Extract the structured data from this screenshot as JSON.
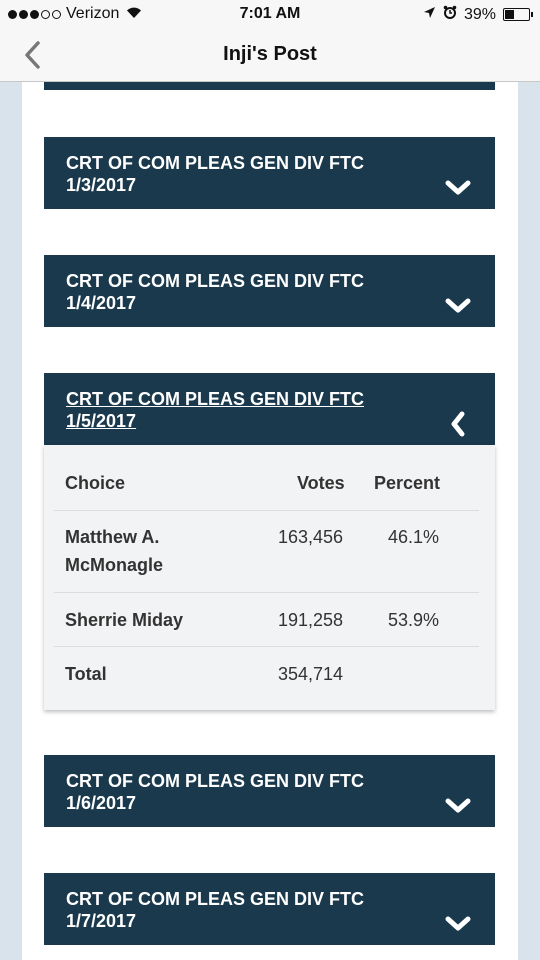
{
  "status_bar": {
    "carrier": "Verizon",
    "time": "7:01 AM",
    "battery": "39%",
    "battery_level": 0.39
  },
  "nav": {
    "title": "Inji's Post"
  },
  "panels": [
    {
      "title": "CRT OF COM PLEAS GEN DIV FTC",
      "date": "1/3/2017",
      "expanded": false
    },
    {
      "title": "CRT OF COM PLEAS GEN DIV FTC",
      "date": "1/4/2017",
      "expanded": false
    },
    {
      "title": "CRT OF COM PLEAS GEN DIV FTC",
      "date": "1/5/2017",
      "expanded": true
    },
    {
      "title": "CRT OF COM PLEAS GEN DIV FTC",
      "date": "1/6/2017",
      "expanded": false
    },
    {
      "title": "CRT OF COM PLEAS GEN DIV FTC",
      "date": "1/7/2017",
      "expanded": false
    }
  ],
  "results": {
    "headers": {
      "choice": "Choice",
      "votes": "Votes",
      "percent": "Percent"
    },
    "rows": [
      {
        "choice_line1": "Matthew A.",
        "choice_line2": "McMonagle",
        "votes": "163,456",
        "percent": "46.1%"
      },
      {
        "choice": "Sherrie Miday",
        "votes": "191,258",
        "percent": "53.9%"
      }
    ],
    "total": {
      "label": "Total",
      "votes": "354,714"
    }
  },
  "colors": {
    "panel_bg": "#1a394d",
    "page_bg": "#d9e3ec",
    "table_bg": "#f2f3f4"
  }
}
